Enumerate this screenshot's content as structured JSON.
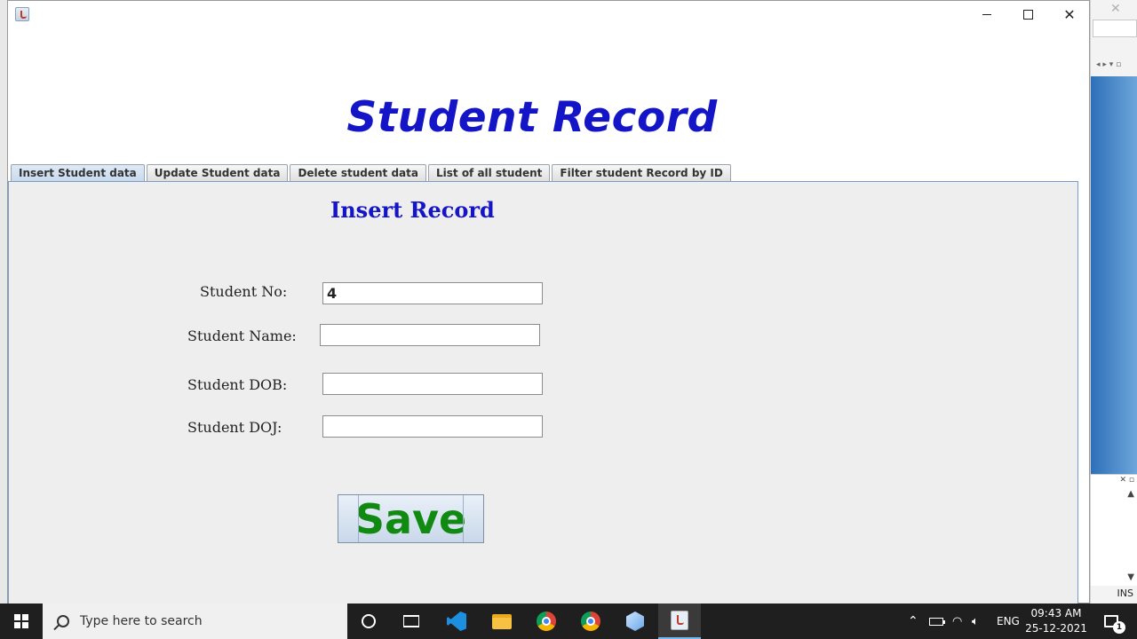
{
  "window": {
    "title": "",
    "controls": {
      "minimize": "—",
      "maximize": "☐",
      "close": "✕"
    }
  },
  "header": {
    "title": "Student Record"
  },
  "tabs": [
    {
      "label": "Insert Student data",
      "active": true
    },
    {
      "label": "Update Student data",
      "active": false
    },
    {
      "label": "Delete student data",
      "active": false
    },
    {
      "label": "List of all student",
      "active": false
    },
    {
      "label": "Filter student Record by ID",
      "active": false
    }
  ],
  "insert_panel": {
    "title": "Insert Record",
    "fields": [
      {
        "label": "Student No:",
        "value": "4"
      },
      {
        "label": "Student Name:",
        "value": ""
      },
      {
        "label": "Student DOB:",
        "value": ""
      },
      {
        "label": "Student DOJ:",
        "value": ""
      }
    ],
    "save_label": "Save"
  },
  "background_ide": {
    "status": "INS"
  },
  "taskbar": {
    "search_placeholder": "Type here to search",
    "language": "ENG",
    "time": "09:43 AM",
    "date": "25-12-2021",
    "notification_count": "1",
    "pinned": [
      "cortana-icon",
      "task-view-icon",
      "vscode-icon",
      "file-explorer-icon",
      "chrome-icon",
      "chrome-profile-icon",
      "3d-viewer-icon",
      "java-app-icon"
    ]
  },
  "colors": {
    "title_blue": "#1515c8",
    "save_green": "#118a11",
    "panel_border": "#7a9cc6",
    "taskbar": "#1f1f1f"
  }
}
